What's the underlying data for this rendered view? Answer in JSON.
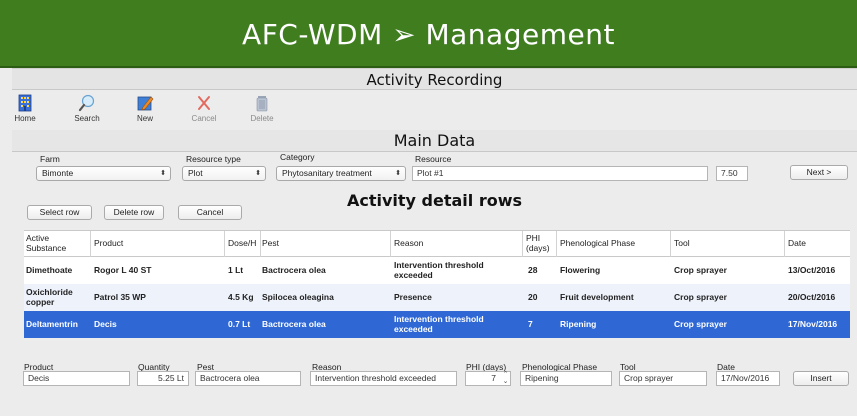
{
  "header": {
    "title": "AFC-WDM ➢ Management"
  },
  "activity_title": "Activity Recording",
  "toolbar": {
    "home": "Home",
    "search": "Search",
    "new": "New",
    "cancel": "Cancel",
    "delete": "Delete"
  },
  "main_data": {
    "title": "Main Data",
    "farm_label": "Farm",
    "farm_value": "Bimonte",
    "resource_type_label": "Resource type",
    "resource_type_value": "Plot",
    "category_label": "Category",
    "category_value": "Phytosanitary treatment",
    "resource_label": "Resource",
    "resource_value": "Plot #1",
    "area_value": "7.50",
    "next_label": "Next >"
  },
  "detail": {
    "title": "Activity detail rows",
    "select_row_label": "Select row",
    "delete_row_label": "Delete row",
    "cancel_label": "Cancel"
  },
  "table": {
    "columns": {
      "active": "Active Substance",
      "product": "Product",
      "dose": "Dose/H",
      "pest": "Pest",
      "reason": "Reason",
      "phi": "PHI (days)",
      "phase": "Phenological Phase",
      "tool": "Tool",
      "date": "Date"
    },
    "rows": [
      {
        "active": "Dimethoate",
        "product": "Rogor L 40 ST",
        "dose": "1 Lt",
        "pest": "Bactrocera olea",
        "reason": "Intervention threshold exceeded",
        "phi": "28",
        "phase": "Flowering",
        "tool": "Crop sprayer",
        "date": "13/Oct/2016"
      },
      {
        "active": "Oxichloride copper",
        "product": "Patrol 35 WP",
        "dose": "4.5 Kg",
        "pest": "Spilocea oleagina",
        "reason": "Presence",
        "phi": "20",
        "phase": "Fruit development",
        "tool": "Crop sprayer",
        "date": "20/Oct/2016"
      },
      {
        "active": "Deltamentrin",
        "product": "Decis",
        "dose": "0.7 Lt",
        "pest": "Bactrocera olea",
        "reason": "Intervention threshold exceeded",
        "phi": "7",
        "phase": "Ripening",
        "tool": "Crop sprayer",
        "date": "17/Nov/2016"
      }
    ]
  },
  "entry": {
    "product_label": "Product",
    "product_value": "Decis",
    "quantity_label": "Quantity",
    "quantity_value": "5.25 Lt",
    "pest_label": "Pest",
    "pest_value": "Bactrocera olea",
    "reason_label": "Reason",
    "reason_value": "Intervention threshold exceeded",
    "phi_label": "PHI (days)",
    "phi_value": "7",
    "phase_label": "Phenological Phase",
    "phase_value": "Ripening",
    "tool_label": "Tool",
    "tool_value": "Crop sprayer",
    "date_label": "Date",
    "date_value": "17/Nov/2016",
    "insert_label": "Insert"
  },
  "colors": {
    "banner": "#3f7d1f",
    "selected_row": "#2f68d5",
    "alt_row": "#eef2fb"
  },
  "icons": [
    "building-icon",
    "magnifier-icon",
    "pencil-icon",
    "x-icon",
    "trash-icon"
  ]
}
